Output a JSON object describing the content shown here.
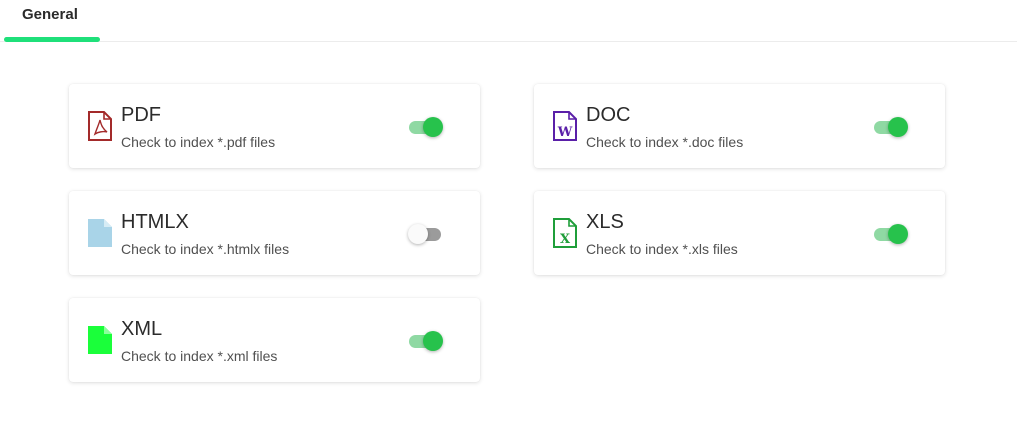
{
  "tabs": [
    {
      "label": "General",
      "active": true
    }
  ],
  "accent_color": "#1fe07a",
  "toggle_on_color": "#27c24c",
  "file_types": [
    {
      "title": "PDF",
      "description": "Check to index *.pdf files",
      "enabled": true,
      "icon": "pdf-file-icon",
      "icon_color": "#a32a2a"
    },
    {
      "title": "DOC",
      "description": "Check to index *.doc files",
      "enabled": true,
      "icon": "word-file-icon",
      "icon_color": "#5a1fa8",
      "icon_text": "W"
    },
    {
      "title": "HTMLX",
      "description": "Check to index *.htmlx files",
      "enabled": false,
      "icon": "html-file-icon",
      "icon_color": "#a9d4e8"
    },
    {
      "title": "XLS",
      "description": "Check to index *.xls files",
      "enabled": true,
      "icon": "excel-file-icon",
      "icon_color": "#1f9e3a",
      "icon_text": "X"
    },
    {
      "title": "XML",
      "description": "Check to index *.xml files",
      "enabled": true,
      "icon": "xml-file-icon",
      "icon_color": "#1aff3a"
    }
  ]
}
